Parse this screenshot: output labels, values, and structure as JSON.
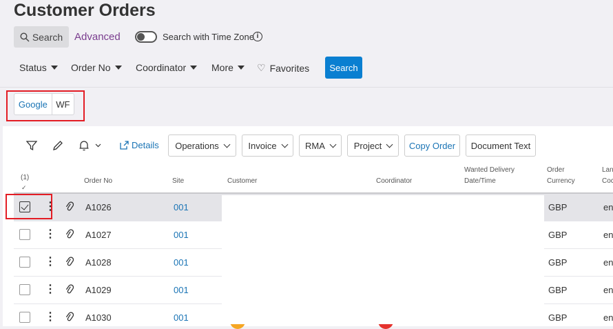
{
  "page": {
    "title": "Customer Orders"
  },
  "search": {
    "search_tab": "Search",
    "advanced_tab": "Advanced",
    "timezone_label": "Search with Time Zone",
    "timezone_enabled": false,
    "info_glyph": "i"
  },
  "filters": {
    "status": "Status",
    "order_no": "Order No",
    "coordinator": "Coordinator",
    "more": "More",
    "favorites": "Favorites",
    "search_button": "Search"
  },
  "tags": [
    "Google",
    "WF"
  ],
  "toolbar": {
    "details": "Details",
    "operations": "Operations",
    "invoice": "Invoice",
    "rma": "RMA",
    "project": "Project",
    "copy_order": "Copy Order",
    "document_text": "Document Text"
  },
  "table": {
    "selected_count": "(1)",
    "headers": {
      "order_no": "Order No",
      "site": "Site",
      "customer": "Customer",
      "coordinator": "Coordinator",
      "wanted_delivery_1": "Wanted Delivery",
      "wanted_delivery_2": "Date/Time",
      "order_currency_1": "Order",
      "order_currency_2": "Currency",
      "lang_1": "Lan",
      "lang_2": "Coc"
    },
    "rows": [
      {
        "order_no": "A1026",
        "site": "001",
        "currency": "GBP",
        "lang": "en",
        "selected": true
      },
      {
        "order_no": "A1027",
        "site": "001",
        "currency": "GBP",
        "lang": "en",
        "selected": false
      },
      {
        "order_no": "A1028",
        "site": "001",
        "currency": "GBP",
        "lang": "en",
        "selected": false
      },
      {
        "order_no": "A1029",
        "site": "001",
        "currency": "GBP",
        "lang": "en",
        "selected": false
      },
      {
        "order_no": "A1030",
        "site": "001",
        "currency": "GBP",
        "lang": "en",
        "selected": false
      }
    ]
  },
  "colors": {
    "accent": "#0a7fd1",
    "link": "#1a74b5",
    "highlight": "#e31c24",
    "advanced": "#7a3d8e"
  }
}
